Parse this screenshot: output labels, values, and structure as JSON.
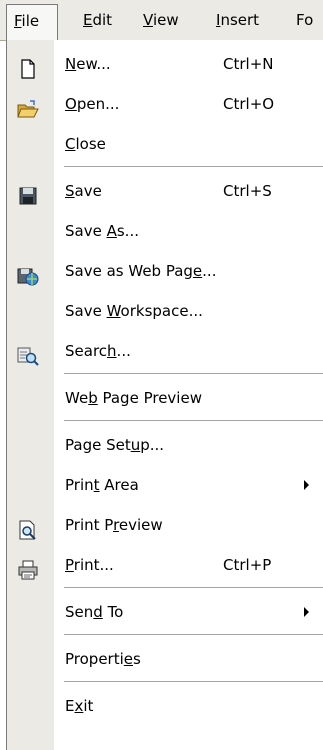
{
  "menubar": [
    {
      "label": "File",
      "accel": 0
    },
    {
      "label": "Edit",
      "accel": 0
    },
    {
      "label": "View",
      "accel": 0
    },
    {
      "label": "Insert",
      "accel": 0
    },
    {
      "label": "Fo",
      "accel": -1
    }
  ],
  "menu": {
    "items": [
      {
        "label": "New...",
        "accel": 0,
        "shortcut": "Ctrl+N",
        "icon": "new-document-icon"
      },
      {
        "label": "Open...",
        "accel": 0,
        "shortcut": "Ctrl+O",
        "icon": "open-folder-icon"
      },
      {
        "label": "Close",
        "accel": 0,
        "shortcut": "",
        "icon": ""
      },
      {
        "label": "Save",
        "accel": 0,
        "shortcut": "Ctrl+S",
        "icon": "save-floppy-icon"
      },
      {
        "label": "Save As...",
        "accel": 5,
        "shortcut": "",
        "icon": ""
      },
      {
        "label": "Save as Web Page...",
        "accel": 15,
        "shortcut": "",
        "icon": "save-web-page-icon"
      },
      {
        "label": "Save Workspace...",
        "accel": 5,
        "shortcut": "",
        "icon": ""
      },
      {
        "label": "Search...",
        "accel": 5,
        "shortcut": "",
        "icon": "search-icon"
      },
      {
        "label": "Web Page Preview",
        "accel": 2,
        "shortcut": "",
        "icon": ""
      },
      {
        "label": "Page Setup...",
        "accel": 8,
        "shortcut": "",
        "icon": ""
      },
      {
        "label": "Print Area",
        "accel": 4,
        "shortcut": "",
        "icon": "",
        "submenu": true
      },
      {
        "label": "Print Preview",
        "accel": 7,
        "shortcut": "",
        "icon": "print-preview-icon"
      },
      {
        "label": "Print...",
        "accel": 0,
        "shortcut": "Ctrl+P",
        "icon": "printer-icon"
      },
      {
        "label": "Send To",
        "accel": 3,
        "shortcut": "",
        "icon": "",
        "submenu": true
      },
      {
        "label": "Properties",
        "accel": 8,
        "shortcut": "",
        "icon": ""
      },
      {
        "label": "Exit",
        "accel": 1,
        "shortcut": "",
        "icon": ""
      }
    ]
  }
}
